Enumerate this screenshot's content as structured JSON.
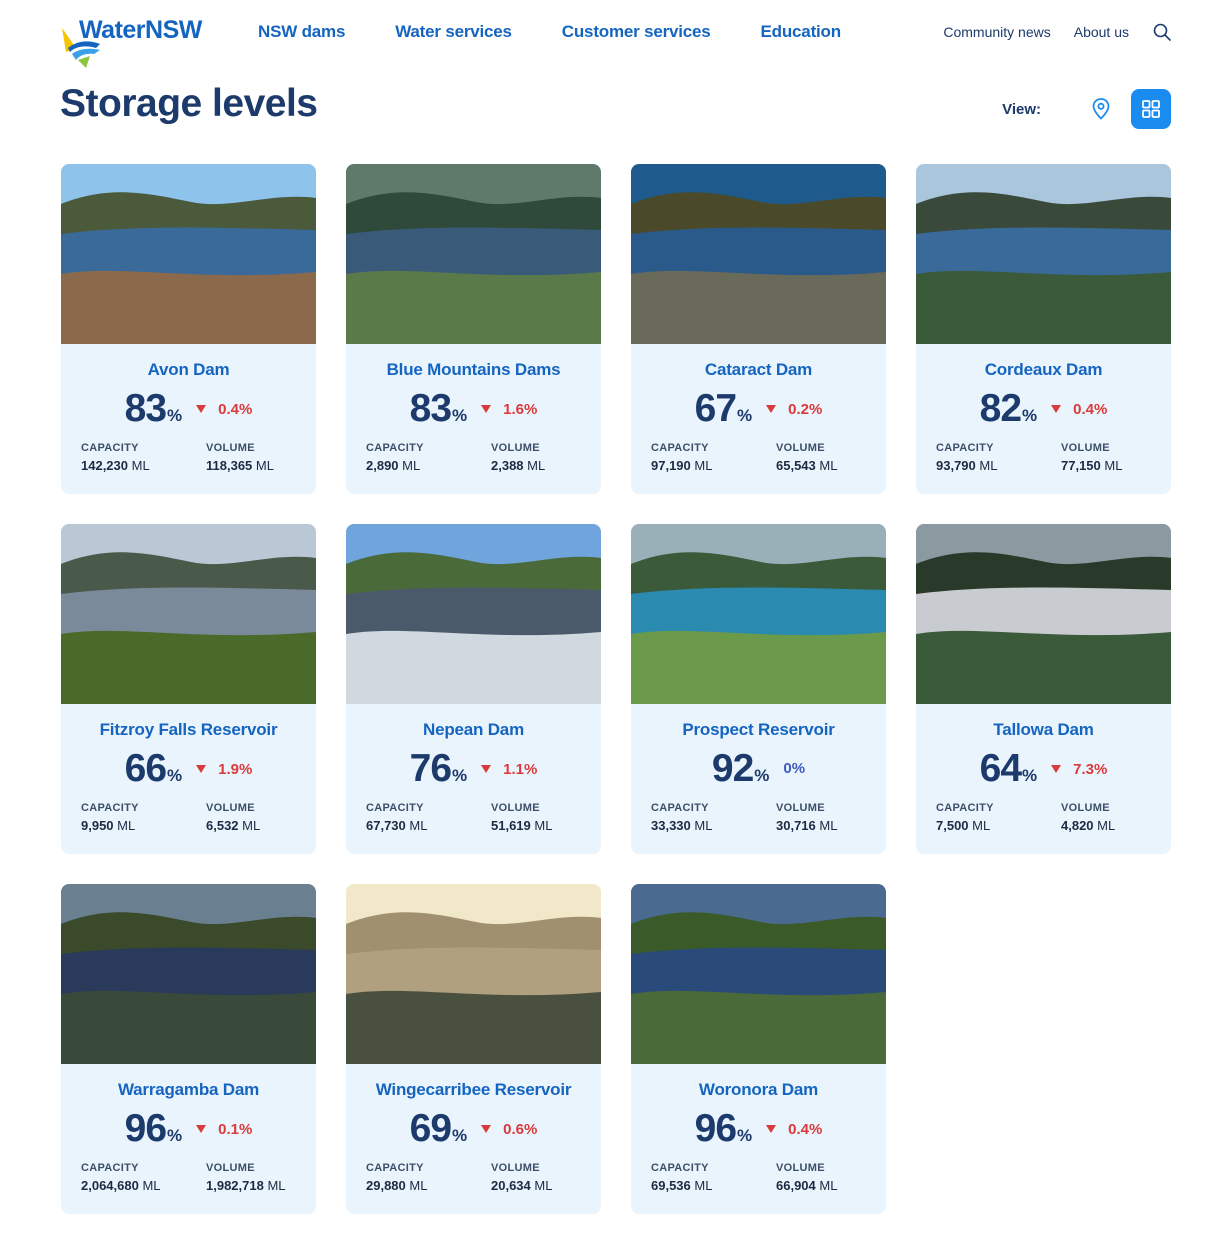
{
  "header": {
    "logo_text": "WaterNSW",
    "nav": [
      "NSW dams",
      "Water services",
      "Customer services",
      "Education"
    ],
    "utility": [
      "Community news",
      "About us"
    ]
  },
  "page": {
    "title": "Storage levels",
    "view_label": "View:"
  },
  "colors": {
    "brand_blue": "#1565c0",
    "accent": "#1a8cf0",
    "card_bg": "#eaf4fd",
    "decrease": "#d93a3a",
    "navy": "#1c3a6b"
  },
  "labels": {
    "capacity": "CAPACITY",
    "volume": "VOLUME",
    "unit": "ML",
    "pct": "%"
  },
  "dams": [
    {
      "name": "Avon Dam",
      "level": "83",
      "change": "0.4%",
      "trend": "down",
      "capacity": "142,230",
      "volume": "118,365"
    },
    {
      "name": "Blue Mountains Dams",
      "level": "83",
      "change": "1.6%",
      "trend": "down",
      "capacity": "2,890",
      "volume": "2,388"
    },
    {
      "name": "Cataract Dam",
      "level": "67",
      "change": "0.2%",
      "trend": "down",
      "capacity": "97,190",
      "volume": "65,543"
    },
    {
      "name": "Cordeaux Dam",
      "level": "82",
      "change": "0.4%",
      "trend": "down",
      "capacity": "93,790",
      "volume": "77,150"
    },
    {
      "name": "Fitzroy Falls Reservoir",
      "level": "66",
      "change": "1.9%",
      "trend": "down",
      "capacity": "9,950",
      "volume": "6,532"
    },
    {
      "name": "Nepean Dam",
      "level": "76",
      "change": "1.1%",
      "trend": "down",
      "capacity": "67,730",
      "volume": "51,619"
    },
    {
      "name": "Prospect Reservoir",
      "level": "92",
      "change": "0%",
      "trend": "none",
      "capacity": "33,330",
      "volume": "30,716"
    },
    {
      "name": "Tallowa Dam",
      "level": "64",
      "change": "7.3%",
      "trend": "down",
      "capacity": "7,500",
      "volume": "4,820"
    },
    {
      "name": "Warragamba Dam",
      "level": "96",
      "change": "0.1%",
      "trend": "down",
      "capacity": "2,064,680",
      "volume": "1,982,718"
    },
    {
      "name": "Wingecarribee Reservoir",
      "level": "69",
      "change": "0.6%",
      "trend": "down",
      "capacity": "29,880",
      "volume": "20,634"
    },
    {
      "name": "Woronora Dam",
      "level": "96",
      "change": "0.4%",
      "trend": "down",
      "capacity": "69,536",
      "volume": "66,904"
    }
  ]
}
